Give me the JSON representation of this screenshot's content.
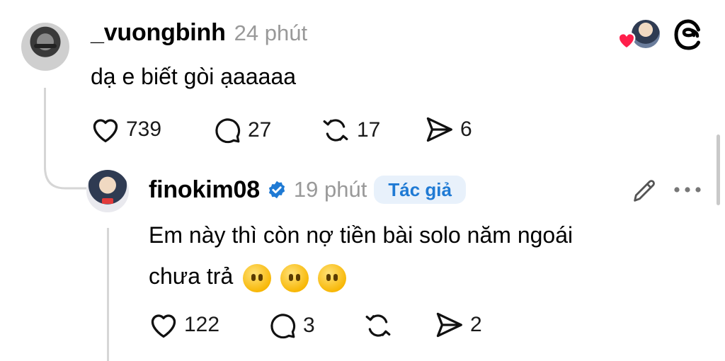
{
  "comment1": {
    "username": "_vuongbinh",
    "time": "24 phút",
    "text": "dạ e biết gòi ạaaaaa",
    "likes": "739",
    "replies": "27",
    "reposts": "17",
    "shares": "6"
  },
  "comment2": {
    "username": "finokim08",
    "time": "19 phút",
    "badge": "Tác giả",
    "text_line1": "Em này thì còn nợ tiền bài solo năm ngoái",
    "text_line2": "chưa trả",
    "likes": "122",
    "replies": "3",
    "shares": "2"
  },
  "icons": {
    "like": "heart-icon",
    "reply": "speech-bubble-icon",
    "repost": "repost-icon",
    "share": "send-icon",
    "edit": "pencil-icon",
    "more": "more-dots-icon",
    "verified": "verified-badge-icon",
    "app_logo": "threads-logo-icon",
    "liked_by_author": "liked-heart-icon"
  },
  "colors": {
    "verified": "#1f7ad4",
    "badge_bg": "#e8f1fb",
    "liked_heart": "#ff1f4b",
    "muted": "#999999"
  }
}
